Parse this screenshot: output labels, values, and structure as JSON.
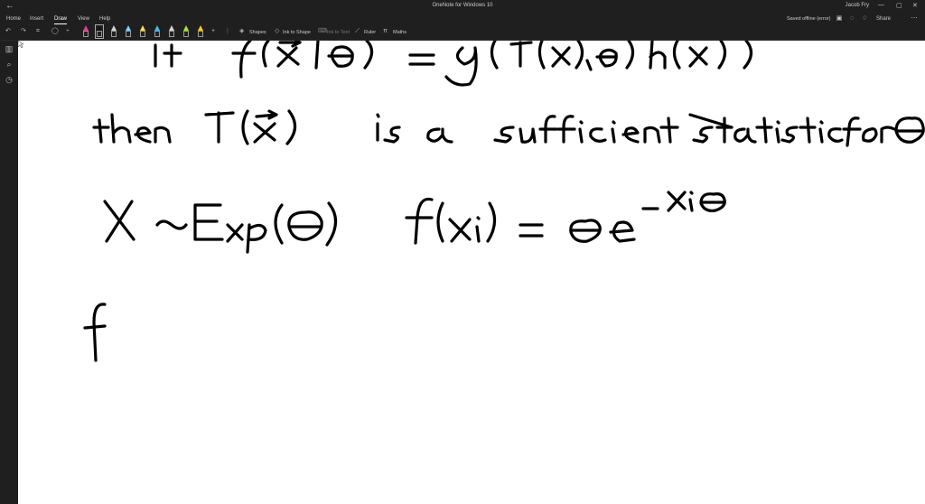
{
  "window": {
    "title": "OneNote for Windows 10",
    "user": "Jacob Fry",
    "back_icon": "back-arrow-icon"
  },
  "ribbon": {
    "tabs": [
      {
        "label": "Home"
      },
      {
        "label": "Insert"
      },
      {
        "label": "Draw"
      },
      {
        "label": "View"
      },
      {
        "label": "Help"
      }
    ],
    "active_tab": "Draw",
    "status": "Saved offline (error)",
    "share_label": "Share"
  },
  "toolbar": {
    "shapes_label": "Shapes",
    "ink_to_shape_label": "Ink to Shape",
    "ink_to_text_label": "Ink to Text",
    "ruler_label": "Ruler",
    "maths_label": "Maths",
    "pen_colors": [
      "#e83a8c",
      "#111111",
      "#d4d4d4",
      "#7dd3fc",
      "#a3e635",
      "#facc15",
      "#38bdf8",
      "#d1d5db",
      "#fde047"
    ]
  }
}
